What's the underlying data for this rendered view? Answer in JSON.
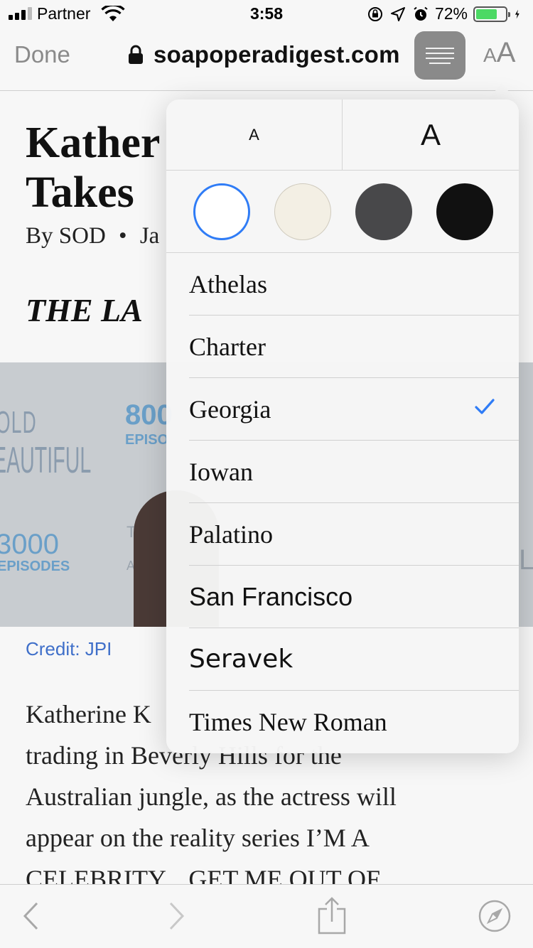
{
  "status_bar": {
    "carrier": "Partner",
    "time": "3:58",
    "battery_percent": "72%",
    "battery_level": 0.72
  },
  "nav": {
    "done_label": "Done",
    "url": "soapoperadigest.com",
    "text_size_small": "A",
    "text_size_large": "A"
  },
  "article": {
    "headline_line1": "Kather",
    "headline_line2": "Takes",
    "byline_author": "By SOD",
    "byline_bullet": "•",
    "byline_date": "Ja",
    "dek": "THE LA",
    "photo_texts": {
      "old": "OLD",
      "beautiful": "EAUTIFUL",
      "count_800": "800",
      "episodes_top": "EPISO",
      "count_3000": "3000",
      "episodes_bottom": "EPISODES",
      "the": "THE",
      "an": "AN",
      "l": "L"
    },
    "credit": "Credit: JPI",
    "body_lines": [
      "Katherine K",
      "trading in Beverly Hills for the",
      "Australian jungle, as the actress will",
      "appear on the reality series I’M A",
      "CELEBRITY... GET ME OUT OF"
    ]
  },
  "popover": {
    "size_small_label": "A",
    "size_large_label": "A",
    "themes": [
      {
        "name": "white",
        "color": "#ffffff",
        "selected": true
      },
      {
        "name": "sepia",
        "color": "#f3efe4",
        "selected": false
      },
      {
        "name": "gray",
        "color": "#48484a",
        "selected": false
      },
      {
        "name": "black",
        "color": "#111111",
        "selected": false
      }
    ],
    "fonts": [
      {
        "label": "Athelas",
        "selected": false
      },
      {
        "label": "Charter",
        "selected": false
      },
      {
        "label": "Georgia",
        "selected": true
      },
      {
        "label": "Iowan",
        "selected": false
      },
      {
        "label": "Palatino",
        "selected": false
      },
      {
        "label": "San Francisco",
        "selected": false
      },
      {
        "label": "Seravek",
        "selected": false
      },
      {
        "label": "Times New Roman",
        "selected": false
      }
    ]
  },
  "colors": {
    "accent_blue": "#2f7cf6",
    "link_blue": "#3f6fc9",
    "battery_green": "#4cd964"
  },
  "toolbar": {
    "icons": [
      "back-icon",
      "forward-icon",
      "share-icon",
      "compass-icon"
    ]
  }
}
